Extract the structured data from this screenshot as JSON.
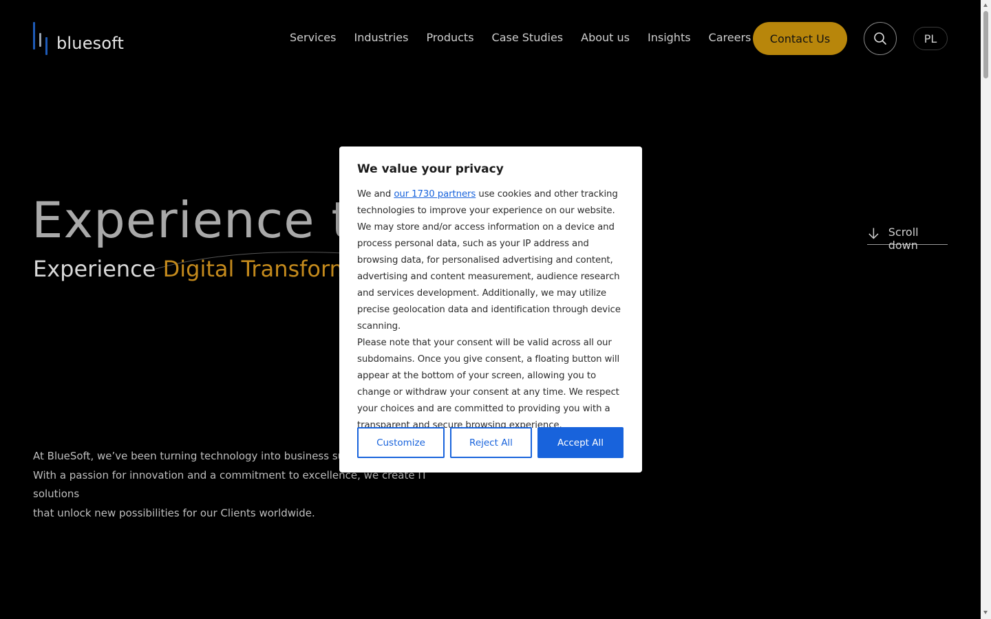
{
  "header": {
    "logo_text": "bluesoft",
    "nav": [
      "Services",
      "Industries",
      "Products",
      "Case Studies",
      "About us",
      "Insights",
      "Careers"
    ],
    "contact_label": "Contact Us",
    "lang_label": "PL",
    "accent_color": "#b8860b"
  },
  "hero": {
    "title": "Experience th",
    "subtitle_prefix": "Experience ",
    "subtitle_accent": "Digital Transformat",
    "scroll_label": "Scroll down",
    "intro": "At BlueSoft, we've been turning technology into business succ... With a passion for innovation and a commitment to excellence, we create IT solutions that unlock new possibilities for our Clients worldwide.",
    "intro_lines": [
      "At BlueSoft, we’ve been turning technology into business succ",
      "With a passion for innovation and a commitment to excellence, we create IT solutions",
      "that unlock new possibilities for our Clients worldwide."
    ]
  },
  "cookie_modal": {
    "title": "We value your privacy",
    "text_before_link": "We and ",
    "link_text": "our 1730 partners",
    "text_after_link": " use cookies and other tracking technologies to improve your experience on our website. We may store and/or access information on a device and process personal data, such as your IP address and browsing data, for personalised advertising and content, advertising and content measurement, audience research and services development. Additionally, we may utilize precise geolocation data and identification through device scanning.",
    "paragraph2": "Please note that your consent will be valid across all our subdomains. Once you give consent, a floating button will appear at the bottom of your screen, allowing you to change or withdraw your consent at any time. We respect your choices and are committed to providing you with a transparent and secure browsing experience.",
    "customize_label": "Customize",
    "reject_label": "Reject All",
    "accept_label": "Accept All",
    "button_color": "#1863dc"
  },
  "icons": {
    "search": "search-icon",
    "scroll": "arrow-down-icon"
  }
}
